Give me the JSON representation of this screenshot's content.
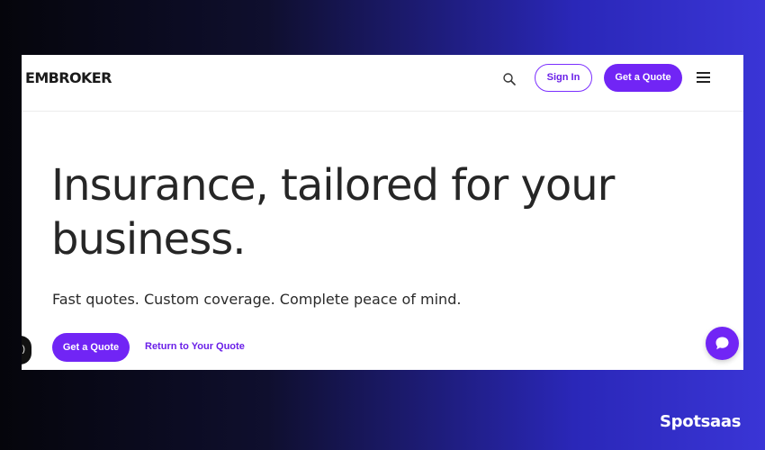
{
  "header": {
    "logo": "EMBROKER",
    "sign_in_label": "Sign In",
    "get_quote_label": "Get a Quote",
    "search_icon": "search-icon",
    "menu_icon": "hamburger-menu-icon"
  },
  "hero": {
    "headline": "Insurance, tailored for your business.",
    "subheadline": "Fast quotes. Custom coverage. Complete peace of mind.",
    "primary_cta": "Get a Quote",
    "secondary_cta": "Return to Your Quote"
  },
  "widgets": {
    "chat_icon": "chat-bubble-icon",
    "side_toggle_glyph": ")"
  },
  "watermark": {
    "text": "Spotsaas"
  },
  "colors": {
    "brand_purple": "#7125f5",
    "text_dark": "#262626",
    "background_gradient_start": "#05050b",
    "background_gradient_end": "#3a35d6"
  }
}
